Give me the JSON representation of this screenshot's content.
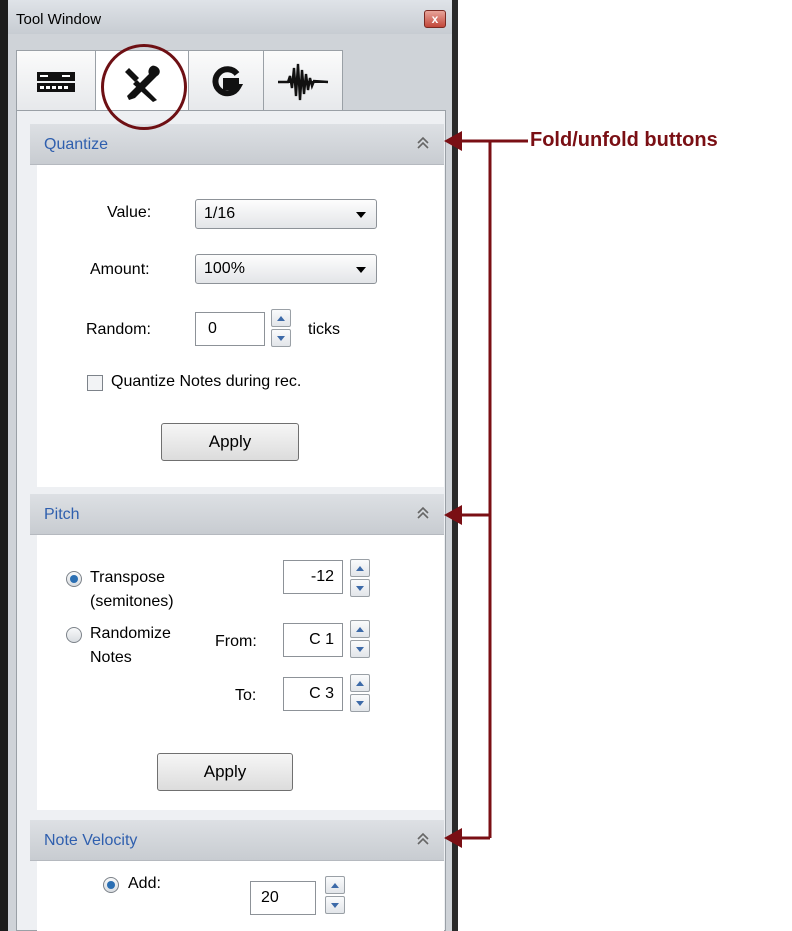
{
  "window": {
    "title": "Tool Window",
    "close_symbol": "x"
  },
  "tabs": [
    {
      "name": "mixer-icon",
      "active": false
    },
    {
      "name": "tools-icon",
      "active": true
    },
    {
      "name": "groove-icon",
      "active": false
    },
    {
      "name": "waveform-icon",
      "active": false
    }
  ],
  "quantize": {
    "title": "Quantize",
    "value_label": "Value:",
    "value_selected": "1/16",
    "amount_label": "Amount:",
    "amount_selected": "100%",
    "random_label": "Random:",
    "random_value": "0",
    "random_unit": "ticks",
    "during_rec_label": "Quantize Notes during rec.",
    "during_rec_checked": false,
    "apply_label": "Apply"
  },
  "pitch": {
    "title": "Pitch",
    "transpose_label_1": "Transpose",
    "transpose_label_2": "(semitones)",
    "transpose_value": "-12",
    "transpose_selected": true,
    "randomize_label_1": "Randomize",
    "randomize_label_2": "Notes",
    "from_label": "From:",
    "from_value": "C 1",
    "to_label": "To:",
    "to_value": "C 3",
    "apply_label": "Apply"
  },
  "velocity": {
    "title": "Note Velocity",
    "add_label": "Add:",
    "add_value": "20",
    "add_selected": true
  },
  "annotation": {
    "label": "Fold/unfold buttons",
    "color": "#7a0f14"
  }
}
